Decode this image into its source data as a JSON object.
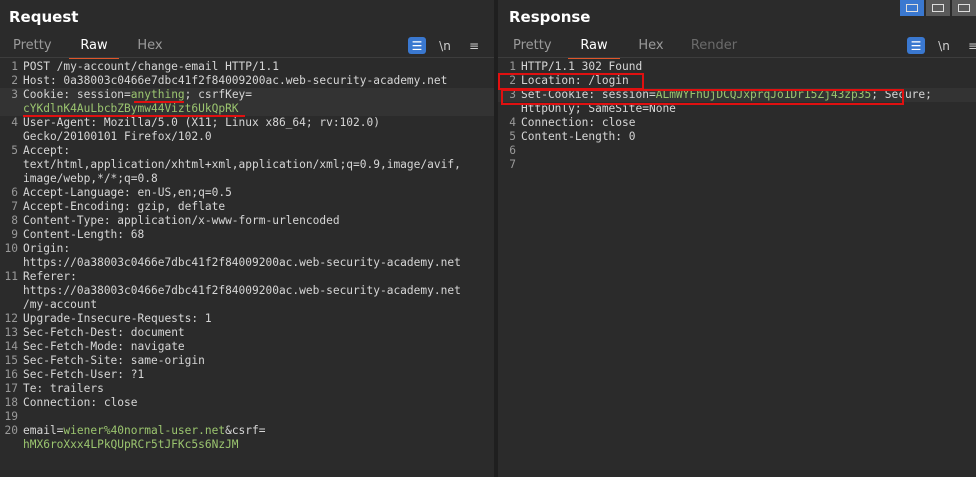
{
  "request": {
    "title": "Request",
    "tabs": [
      "Pretty",
      "Raw",
      "Hex"
    ],
    "active_tab": "Raw",
    "lines": [
      {
        "n": "1",
        "parts": [
          {
            "t": "POST /my-account/change-email HTTP/1.1",
            "c": "val"
          }
        ]
      },
      {
        "n": "2",
        "parts": [
          {
            "t": "Host: ",
            "c": "hk"
          },
          {
            "t": "0a38003c0466e7dbc41f2f84009200ac.web-security-academy.net",
            "c": "val"
          }
        ]
      },
      {
        "n": "3",
        "parts": [
          {
            "t": "Cookie: ",
            "c": "hk"
          },
          {
            "t": "session=",
            "c": "val"
          },
          {
            "t": "anything",
            "c": "green"
          },
          {
            "t": "; csrfKey=",
            "c": "val"
          }
        ],
        "cur": true
      },
      {
        "n": "",
        "parts": [
          {
            "t": "cYKdlnK4AuLbcbZBymw44Vizt6UkQpRK",
            "c": "green"
          }
        ],
        "cur": true
      },
      {
        "n": "4",
        "parts": [
          {
            "t": "User-Agent: ",
            "c": "hk"
          },
          {
            "t": "Mozilla/5.0 (X11; Linux x86_64; rv:102.0)",
            "c": "val"
          }
        ]
      },
      {
        "n": "",
        "parts": [
          {
            "t": "Gecko/20100101 Firefox/102.0",
            "c": "val"
          }
        ]
      },
      {
        "n": "5",
        "parts": [
          {
            "t": "Accept:",
            "c": "hk"
          }
        ]
      },
      {
        "n": "",
        "parts": [
          {
            "t": "text/html,application/xhtml+xml,application/xml;q=0.9,image/avif,",
            "c": "val"
          }
        ]
      },
      {
        "n": "",
        "parts": [
          {
            "t": "image/webp,*/*;q=0.8",
            "c": "val"
          }
        ]
      },
      {
        "n": "6",
        "parts": [
          {
            "t": "Accept-Language: ",
            "c": "hk"
          },
          {
            "t": "en-US,en;q=0.5",
            "c": "val"
          }
        ]
      },
      {
        "n": "7",
        "parts": [
          {
            "t": "Accept-Encoding: ",
            "c": "hk"
          },
          {
            "t": "gzip, deflate",
            "c": "val"
          }
        ]
      },
      {
        "n": "8",
        "parts": [
          {
            "t": "Content-Type: ",
            "c": "hk"
          },
          {
            "t": "application/x-www-form-urlencoded",
            "c": "val"
          }
        ]
      },
      {
        "n": "9",
        "parts": [
          {
            "t": "Content-Length: ",
            "c": "hk"
          },
          {
            "t": "68",
            "c": "val"
          }
        ]
      },
      {
        "n": "10",
        "parts": [
          {
            "t": "Origin:",
            "c": "hk"
          }
        ]
      },
      {
        "n": "",
        "parts": [
          {
            "t": "https://0a38003c0466e7dbc41f2f84009200ac.web-security-academy.net",
            "c": "val"
          }
        ]
      },
      {
        "n": "11",
        "parts": [
          {
            "t": "Referer:",
            "c": "hk"
          }
        ]
      },
      {
        "n": "",
        "parts": [
          {
            "t": "https://0a38003c0466e7dbc41f2f84009200ac.web-security-academy.net",
            "c": "val"
          }
        ]
      },
      {
        "n": "",
        "parts": [
          {
            "t": "/my-account",
            "c": "val"
          }
        ]
      },
      {
        "n": "12",
        "parts": [
          {
            "t": "Upgrade-Insecure-Requests: ",
            "c": "hk"
          },
          {
            "t": "1",
            "c": "val"
          }
        ]
      },
      {
        "n": "13",
        "parts": [
          {
            "t": "Sec-Fetch-Dest: ",
            "c": "hk"
          },
          {
            "t": "document",
            "c": "val"
          }
        ]
      },
      {
        "n": "14",
        "parts": [
          {
            "t": "Sec-Fetch-Mode: ",
            "c": "hk"
          },
          {
            "t": "navigate",
            "c": "val"
          }
        ]
      },
      {
        "n": "15",
        "parts": [
          {
            "t": "Sec-Fetch-Site: ",
            "c": "hk"
          },
          {
            "t": "same-origin",
            "c": "val"
          }
        ]
      },
      {
        "n": "16",
        "parts": [
          {
            "t": "Sec-Fetch-User: ",
            "c": "hk"
          },
          {
            "t": "?1",
            "c": "val"
          }
        ]
      },
      {
        "n": "17",
        "parts": [
          {
            "t": "Te: ",
            "c": "hk"
          },
          {
            "t": "trailers",
            "c": "val"
          }
        ]
      },
      {
        "n": "18",
        "parts": [
          {
            "t": "Connection: ",
            "c": "hk"
          },
          {
            "t": "close",
            "c": "val"
          }
        ]
      },
      {
        "n": "19",
        "parts": []
      },
      {
        "n": "20",
        "parts": [
          {
            "t": "email=",
            "c": "val"
          },
          {
            "t": "wiener%40normal-user.net",
            "c": "green"
          },
          {
            "t": "&csrf=",
            "c": "val"
          }
        ]
      },
      {
        "n": "",
        "parts": [
          {
            "t": "hMX6roXxx4LPkQUpRCr5tJFKc5s6NzJM",
            "c": "green"
          }
        ]
      }
    ]
  },
  "response": {
    "title": "Response",
    "tabs": [
      "Pretty",
      "Raw",
      "Hex",
      "Render"
    ],
    "active_tab": "Raw",
    "lines": [
      {
        "n": "1",
        "parts": [
          {
            "t": "HTTP/1.1 302 Found",
            "c": "val"
          }
        ]
      },
      {
        "n": "2",
        "parts": [
          {
            "t": "Location: ",
            "c": "hk"
          },
          {
            "t": "/login",
            "c": "val"
          }
        ]
      },
      {
        "n": "3",
        "parts": [
          {
            "t": "Set-Cookie: ",
            "c": "hk"
          },
          {
            "t": "session=",
            "c": "val"
          },
          {
            "t": "ALmWYFhUjDCQJxprqJo1Dr15Zj43zp35",
            "c": "green"
          },
          {
            "t": "; Secure;",
            "c": "val"
          }
        ],
        "cur": true
      },
      {
        "n": "",
        "parts": [
          {
            "t": "HttpOnly; SameSite=None",
            "c": "val"
          }
        ]
      },
      {
        "n": "4",
        "parts": [
          {
            "t": "Connection: ",
            "c": "hk"
          },
          {
            "t": "close",
            "c": "val"
          }
        ]
      },
      {
        "n": "5",
        "parts": [
          {
            "t": "Content-Length: ",
            "c": "hk"
          },
          {
            "t": "0",
            "c": "val"
          }
        ]
      },
      {
        "n": "6",
        "parts": []
      },
      {
        "n": "7",
        "parts": []
      }
    ]
  },
  "tools": {
    "wrap": "\\n",
    "menu": "≡"
  },
  "colors": {
    "accent_tab": "#e0562a",
    "highlight_box": "#e01010",
    "value_green": "#9bc56f",
    "toolbar_blue": "#3a78d0"
  }
}
